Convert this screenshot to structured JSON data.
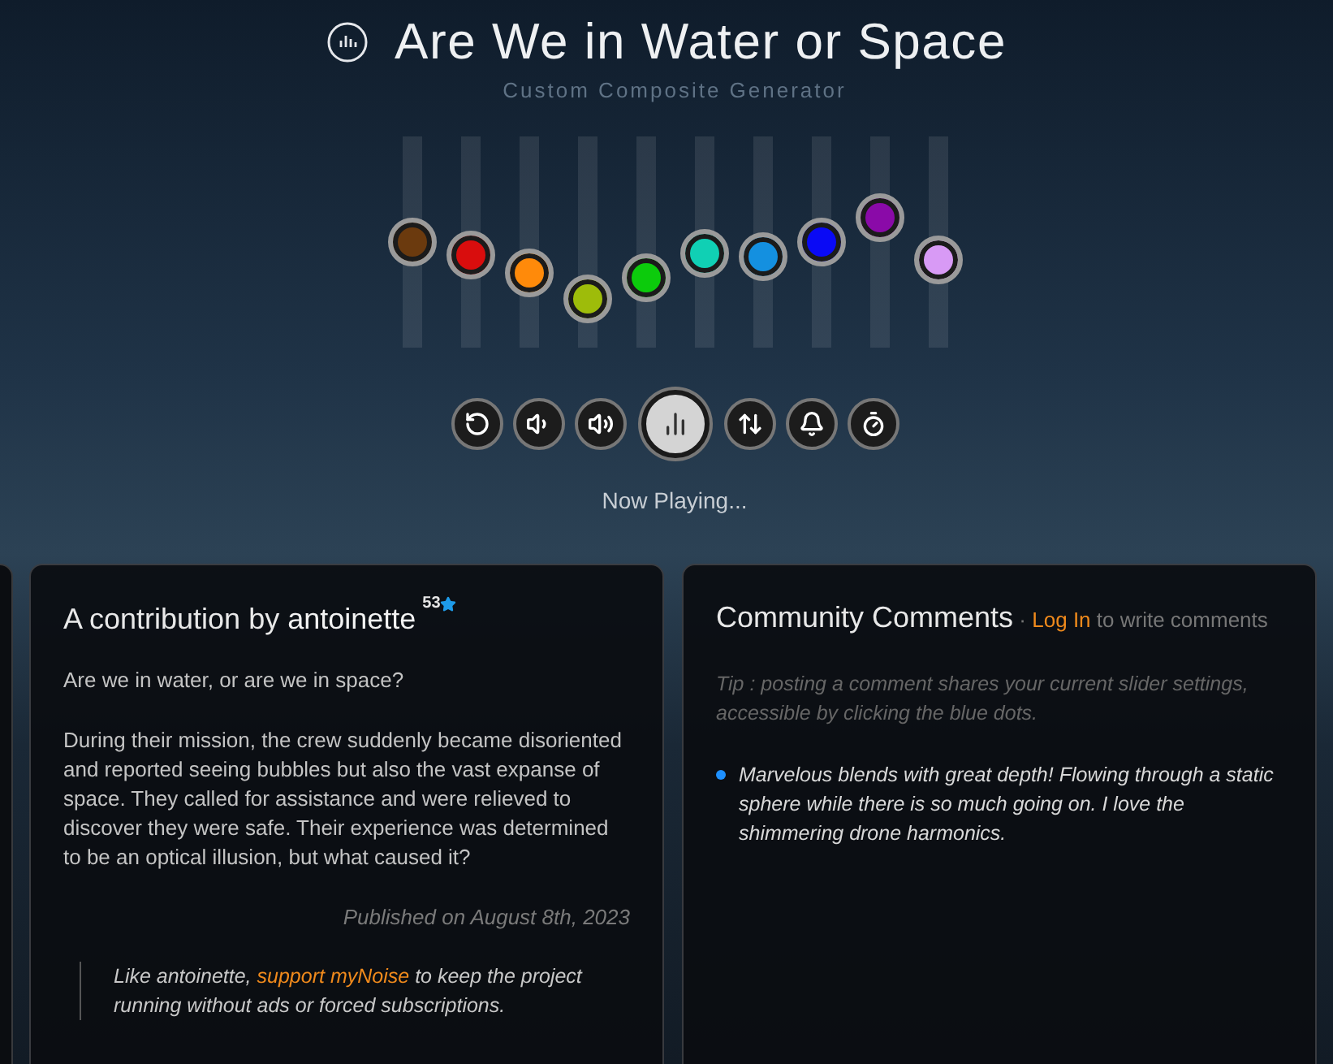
{
  "header": {
    "title": "Are We in Water or Space",
    "subtitle": "Custom Composite Generator"
  },
  "sliders": [
    {
      "color": "#6b3a0e",
      "level": 0.5
    },
    {
      "color": "#d90d0d",
      "level": 0.41
    },
    {
      "color": "#ff8a0a",
      "level": 0.28
    },
    {
      "color": "#9ebc0a",
      "level": 0.11
    },
    {
      "color": "#0ccb0c",
      "level": 0.25
    },
    {
      "color": "#10d0b4",
      "level": 0.42
    },
    {
      "color": "#1490e0",
      "level": 0.39
    },
    {
      "color": "#0a0af5",
      "level": 0.49
    },
    {
      "color": "#8a0aa8",
      "level": 0.66
    },
    {
      "color": "#d89af5",
      "level": 0.37
    }
  ],
  "controls": [
    {
      "kind": "reset"
    },
    {
      "kind": "volume-down"
    },
    {
      "kind": "volume-up"
    },
    {
      "kind": "play"
    },
    {
      "kind": "sliders"
    },
    {
      "kind": "bell"
    },
    {
      "kind": "timer"
    }
  ],
  "status": "Now Playing...",
  "contribution": {
    "prefix": "A contribution by",
    "author": "antoinette",
    "stars": "53",
    "question": "Are we in water, or are we in space?",
    "story": "During their mission, the crew suddenly became disoriented and reported seeing bubbles but also the vast expanse of space. They called for assistance and were relieved to discover they were safe. Their experience was determined to be an optical illusion, but what caused it?",
    "published": "Published on August 8th, 2023",
    "support_before": "Like antoinette,",
    "support_link": "support myNoise",
    "support_after": "to keep the project running without ads or forced subscriptions."
  },
  "comments": {
    "title": "Community Comments",
    "separator": "·",
    "login": "Log In",
    "login_after": "to write comments",
    "tip": "Tip : posting a comment shares your current slider settings, accessible by clicking the blue dots.",
    "items": [
      {
        "color": "#1e90ff",
        "text": "Marvelous blends with great depth! Flowing through a static sphere while there is so much going on. I love the shimmering drone harmonics."
      }
    ]
  }
}
